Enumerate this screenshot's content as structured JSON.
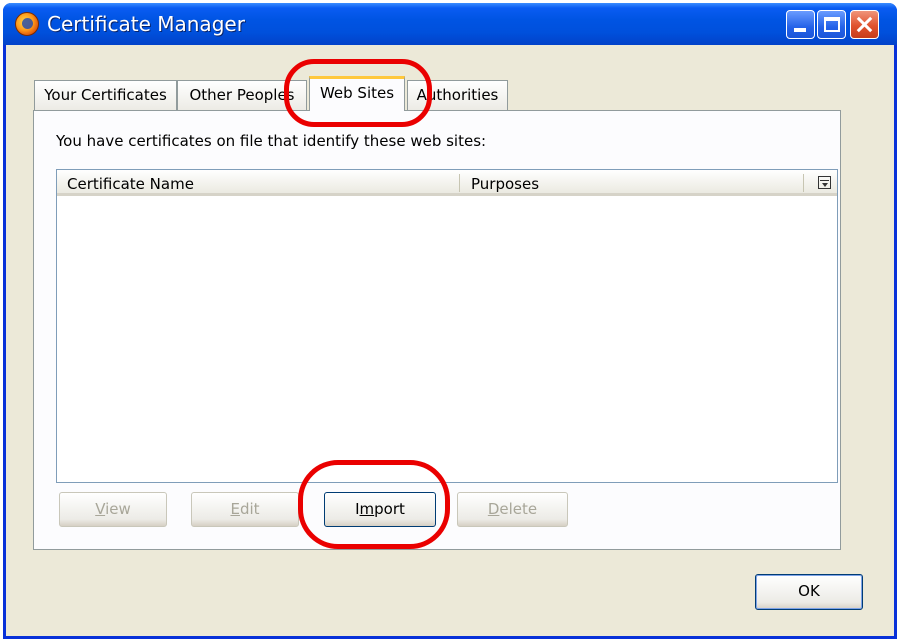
{
  "window": {
    "title": "Certificate Manager",
    "app_icon": "firefox-icon"
  },
  "tabs": [
    {
      "label": "Your Certificates",
      "selected": false
    },
    {
      "label": "Other Peoples",
      "selected": false
    },
    {
      "label": "Web Sites",
      "selected": true
    },
    {
      "label": "Authorities",
      "selected": false
    }
  ],
  "panel": {
    "description": "You have certificates on file that identify these web sites:",
    "columns": [
      "Certificate Name",
      "Purposes"
    ],
    "column_picker_icon": "column-picker-icon"
  },
  "buttons": {
    "view": {
      "pre": "",
      "key": "V",
      "post": "iew",
      "enabled": false
    },
    "edit": {
      "pre": "",
      "key": "E",
      "post": "dit",
      "enabled": false
    },
    "import": {
      "pre": "I",
      "key": "m",
      "post": "port",
      "enabled": true
    },
    "delete": {
      "pre": "",
      "key": "D",
      "post": "elete",
      "enabled": false
    },
    "ok": {
      "label": "OK"
    }
  },
  "colors": {
    "titlebar": "#0054e3",
    "annotation": "#ea0000",
    "selected_tab_accent": "#ffc83c"
  }
}
